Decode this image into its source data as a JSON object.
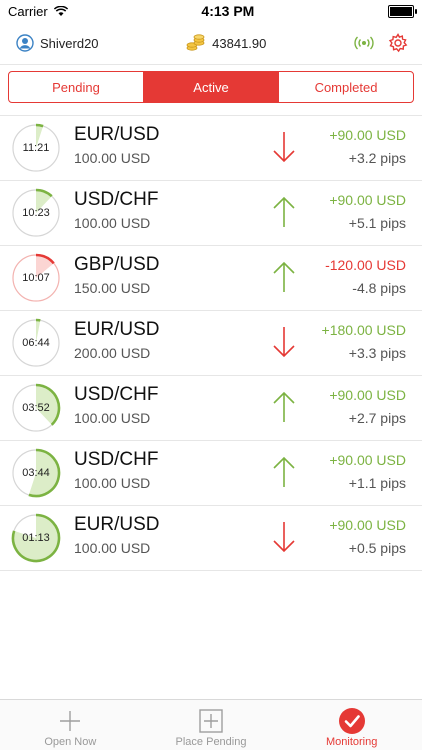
{
  "status_bar": {
    "carrier": "Carrier",
    "time": "4:13 PM"
  },
  "header": {
    "username": "Shiverd20",
    "balance": "43841.90"
  },
  "tabs": [
    {
      "label": "Pending",
      "active": false
    },
    {
      "label": "Active",
      "active": true
    },
    {
      "label": "Completed",
      "active": false
    }
  ],
  "positions": [
    {
      "time": "11:21",
      "pair": "EUR/USD",
      "amount": "100.00 USD",
      "direction": "down",
      "profit": "+90.00 USD",
      "pips": "+3.2 pips",
      "profit_state": "win",
      "elapsed_fraction": 0.05
    },
    {
      "time": "10:23",
      "pair": "USD/CHF",
      "amount": "100.00 USD",
      "direction": "up",
      "profit": "+90.00 USD",
      "pips": "+5.1 pips",
      "profit_state": "win",
      "elapsed_fraction": 0.12
    },
    {
      "time": "10:07",
      "pair": "GBP/USD",
      "amount": "150.00 USD",
      "direction": "up",
      "profit": "-120.00 USD",
      "pips": "-4.8 pips",
      "profit_state": "loss",
      "elapsed_fraction": 0.14
    },
    {
      "time": "06:44",
      "pair": "EUR/USD",
      "amount": "200.00 USD",
      "direction": "down",
      "profit": "+180.00 USD",
      "pips": "+3.3 pips",
      "profit_state": "win",
      "elapsed_fraction": 0.03
    },
    {
      "time": "03:52",
      "pair": "USD/CHF",
      "amount": "100.00 USD",
      "direction": "up",
      "profit": "+90.00 USD",
      "pips": "+2.7 pips",
      "profit_state": "win",
      "elapsed_fraction": 0.38
    },
    {
      "time": "03:44",
      "pair": "USD/CHF",
      "amount": "100.00 USD",
      "direction": "up",
      "profit": "+90.00 USD",
      "pips": "+1.1 pips",
      "profit_state": "win",
      "elapsed_fraction": 0.55
    },
    {
      "time": "01:13",
      "pair": "EUR/USD",
      "amount": "100.00 USD",
      "direction": "down",
      "profit": "+90.00 USD",
      "pips": "+0.5 pips",
      "profit_state": "win",
      "elapsed_fraction": 0.8
    }
  ],
  "bottom_tabs": [
    {
      "label": "Open Now",
      "icon": "plus-icon",
      "active": false
    },
    {
      "label": "Place Pending",
      "icon": "plus-square-icon",
      "active": false
    },
    {
      "label": "Monitoring",
      "icon": "check-circle-icon",
      "active": true
    }
  ],
  "colors": {
    "accent": "#e53935",
    "win": "#7cb342",
    "loss": "#e53935"
  }
}
